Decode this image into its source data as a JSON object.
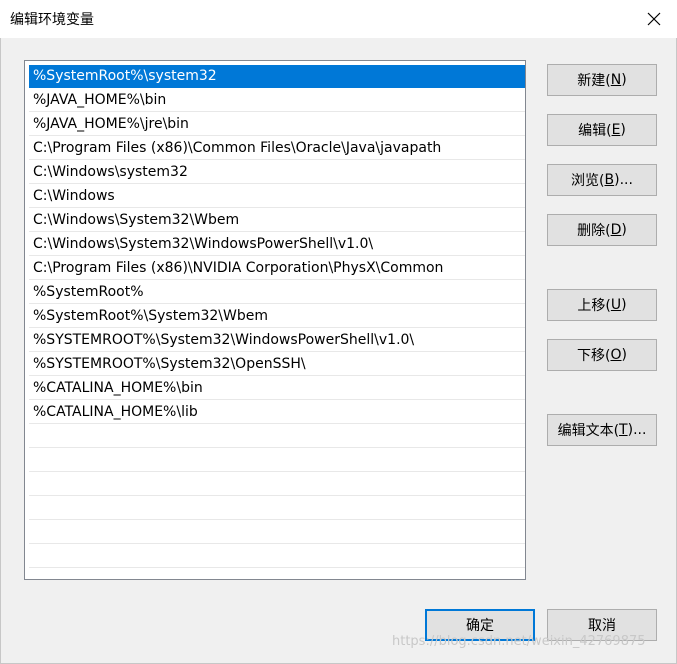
{
  "window": {
    "title": "编辑环境变量"
  },
  "paths": [
    "%SystemRoot%\\system32",
    "%JAVA_HOME%\\bin",
    "%JAVA_HOME%\\jre\\bin",
    "C:\\Program Files (x86)\\Common Files\\Oracle\\Java\\javapath",
    "C:\\Windows\\system32",
    "C:\\Windows",
    "C:\\Windows\\System32\\Wbem",
    "C:\\Windows\\System32\\WindowsPowerShell\\v1.0\\",
    "C:\\Program Files (x86)\\NVIDIA Corporation\\PhysX\\Common",
    "%SystemRoot%",
    "%SystemRoot%\\System32\\Wbem",
    "%SYSTEMROOT%\\System32\\WindowsPowerShell\\v1.0\\",
    "%SYSTEMROOT%\\System32\\OpenSSH\\",
    "%CATALINA_HOME%\\bin",
    "%CATALINA_HOME%\\lib"
  ],
  "selected_index": 0,
  "buttons": {
    "new": {
      "label": "新建(",
      "key": "N",
      "tail": ")"
    },
    "edit": {
      "label": "编辑(",
      "key": "E",
      "tail": ")"
    },
    "browse": {
      "label": "浏览(",
      "key": "B",
      "tail": ")..."
    },
    "delete": {
      "label": "删除(",
      "key": "D",
      "tail": ")"
    },
    "move_up": {
      "label": "上移(",
      "key": "U",
      "tail": ")"
    },
    "move_down": {
      "label": "下移(",
      "key": "O",
      "tail": ")"
    },
    "edit_text": {
      "label": "编辑文本(",
      "key": "T",
      "tail": ")..."
    }
  },
  "footer": {
    "ok_label": "确定",
    "cancel_label": "取消"
  },
  "watermark": "https://blog.csdn.net/weixin_42769875",
  "colors": {
    "selection": "#0078d7",
    "button_face": "#e1e1e1",
    "default_button_border": "#0078d7"
  }
}
